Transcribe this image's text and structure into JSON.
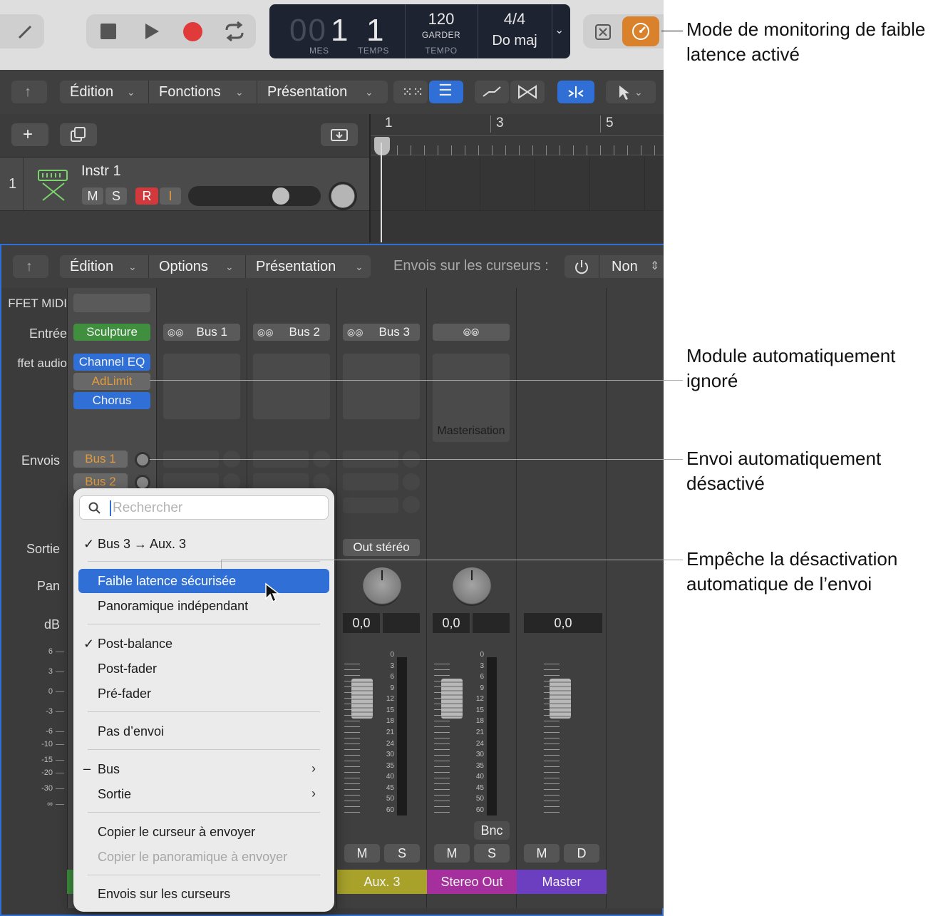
{
  "lcd": {
    "bar": "001",
    "beat": "1",
    "bar_label": "MES",
    "beat_label": "TEMPS",
    "tempo": "120",
    "tempo_mode": "GARDER",
    "tempo_label": "TEMPO",
    "signature": "4/4",
    "key": "Do maj"
  },
  "tracks_toolbar": {
    "edit": "Édition",
    "functions": "Fonctions",
    "view": "Présentation"
  },
  "ruler": {
    "marks": [
      "1",
      "3",
      "5"
    ]
  },
  "track": {
    "number": "1",
    "name": "Instr 1",
    "mute": "M",
    "solo": "S",
    "record": "R",
    "input": "I"
  },
  "mixer_toolbar": {
    "edit": "Édition",
    "options": "Options",
    "view": "Présentation",
    "sends_on_faders_label": "Envois sur les curseurs :",
    "sends_value": "Non"
  },
  "row_labels": {
    "midi_fx": "FFET MIDI",
    "input": "Entrée",
    "audio_fx": "ffet audio",
    "sends": "Envois",
    "output": "Sortie",
    "pan": "Pan",
    "db": "dB"
  },
  "channel1": {
    "input": "Sculpture",
    "plugins": [
      "Channel EQ",
      "AdLimit",
      "Chorus"
    ],
    "sends": [
      "Bus 1",
      "Bus 2"
    ]
  },
  "channels": [
    {
      "input": "Bus 1"
    },
    {
      "input": "Bus 2"
    },
    {
      "input": "Bus 3",
      "output": "Out stéréo",
      "db": "0,0",
      "mute": "M",
      "solo": "S",
      "name": "Aux. 3",
      "color": "#a8a22b"
    },
    {
      "input": "",
      "plugin": "Masterisation",
      "db": "0,0",
      "mute": "M",
      "solo": "S",
      "bounce": "Bnc",
      "name": "Stereo Out",
      "color": "#a52f9c"
    },
    {
      "db": "0,0",
      "mute": "M",
      "dim": "D",
      "name": "Master",
      "color": "#6b3fbf"
    }
  ],
  "scale_left": [
    "6",
    "3",
    "0",
    "-3",
    "-6",
    "-10",
    "-15",
    "-20",
    "-30",
    "∞"
  ],
  "scale_meter": [
    "0",
    "3",
    "6",
    "9",
    "12",
    "15",
    "18",
    "21",
    "24",
    "30",
    "35",
    "40",
    "45",
    "50",
    "60"
  ],
  "menu": {
    "search_placeholder": "Rechercher",
    "route": "Bus 3 → Aux. 3",
    "low_latency": "Faible latence sécurisée",
    "independent_pan": "Panoramique indépendant",
    "post_pan": "Post-balance",
    "post_fader": "Post-fader",
    "pre_fader": "Pré-fader",
    "no_send": "Pas d’envoi",
    "bus": "Bus",
    "output": "Sortie",
    "copy_fader": "Copier le curseur à envoyer",
    "copy_pan": "Copier le panoramique à envoyer",
    "sends_on_faders": "Envois sur les curseurs"
  },
  "callouts": {
    "low_latency_mode": "Mode de monitoring de faible latence activé",
    "plugin_bypassed": "Module automatiquement ignoré",
    "send_disabled": "Envoi automatiquement désactivé",
    "prevent_disable": "Empêche la désactivation automatique de l’envoi"
  },
  "colors": {
    "accent_blue": "#2f6fd6",
    "low_latency_orange": "#d9822b",
    "record_red": "#e03a3a"
  }
}
